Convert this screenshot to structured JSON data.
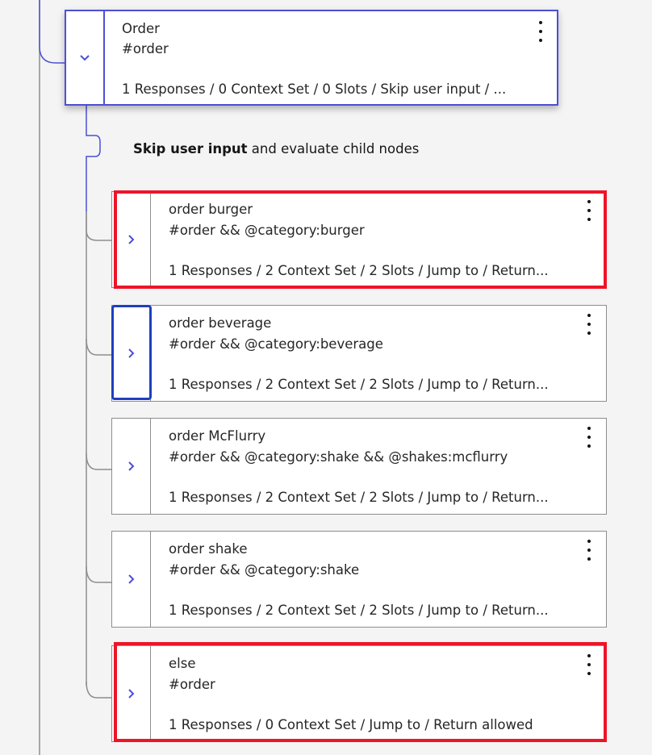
{
  "parent_node": {
    "title": "Order",
    "condition": "#order",
    "summary": "1 Responses / 0 Context Set / 0 Slots / Skip user input / ...",
    "expanded": true
  },
  "skip_notice": {
    "bold": "Skip user input",
    "rest": " and evaluate child nodes"
  },
  "children": [
    {
      "title": "order burger",
      "condition": "#order && @category:burger",
      "summary": "1 Responses / 2 Context Set / 2 Slots / Jump to / Return...",
      "highlighted": true
    },
    {
      "title": "order beverage",
      "condition": "#order && @category:beverage",
      "summary": "1 Responses / 2 Context Set / 2 Slots / Jump to / Return...",
      "focused": true
    },
    {
      "title": "order McFlurry",
      "condition": "#order && @category:shake && @shakes:mcflurry",
      "summary": "1 Responses / 2 Context Set / 2 Slots / Jump to / Return..."
    },
    {
      "title": "order shake",
      "condition": "#order && @category:shake",
      "summary": "1 Responses / 2 Context Set / 2 Slots / Jump to / Return..."
    },
    {
      "title": "else",
      "condition": "#order",
      "summary": "1 Responses / 0 Context Set / Jump to / Return allowed",
      "highlighted": true
    }
  ],
  "icons": {
    "expand": "chevron-right-icon",
    "collapse": "chevron-down-icon",
    "menu": "overflow-menu-vertical-icon"
  },
  "colors": {
    "background": "#f4f4f4",
    "accent": "#4d4fd6",
    "highlight": "#ee1428",
    "focus": "#1f3fbf",
    "connector": "#8d8d8d"
  }
}
